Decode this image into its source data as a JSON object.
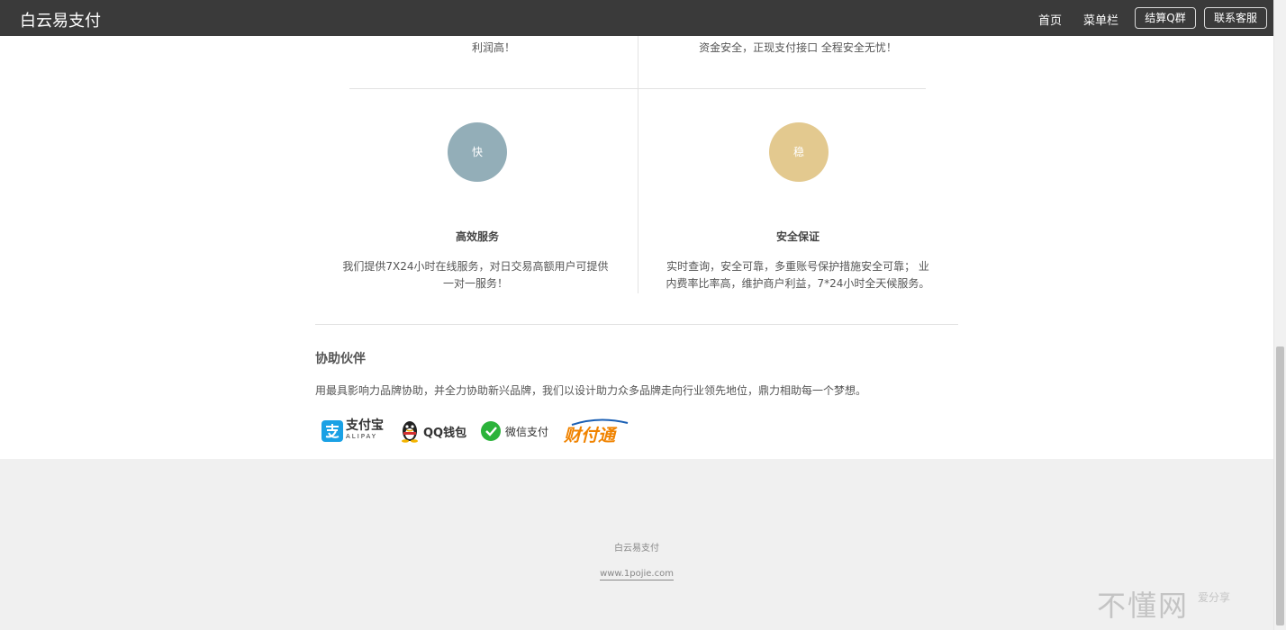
{
  "header": {
    "brand": "白云易支付",
    "nav": {
      "home": "首页",
      "menu": "菜单栏",
      "group_btn": "结算Q群",
      "contact_btn": "联系客服"
    }
  },
  "features": {
    "top_left_partial": "利润高！",
    "top_right_partial": "资金安全，正现支付接口 全程安全无忧！",
    "items": [
      {
        "icon_label": "快",
        "title": "高效服务",
        "desc": "我们提供7X24小时在线服务，对日交易高额用户可提供一对一服务！",
        "color": "#93aeb8"
      },
      {
        "icon_label": "稳",
        "title": "安全保证",
        "desc": "实时查询，安全可靠，多重账号保护措施安全可靠； 业内费率比率高，维护商户利益，7*24小时全天候服务。",
        "color": "#e3c98f"
      }
    ]
  },
  "partners": {
    "title": "协助伙伴",
    "desc": "用最具影响力品牌协助，并全力协助新兴品牌，我们以设计助力众多品牌走向行业领先地位，鼎力相助每一个梦想。",
    "logos": [
      {
        "name": "支付宝",
        "sub": "ALIPAY",
        "color": "#1aa1e5"
      },
      {
        "name": "QQ钱包",
        "color": "#333333"
      },
      {
        "name": "微信支付",
        "color": "#2bb33a"
      },
      {
        "name": "财付通",
        "color": "#f08300"
      }
    ]
  },
  "footer": {
    "name": "白云易支付",
    "url": "www.1pojie.com"
  },
  "watermark": {
    "main": "不懂网",
    "sub": "爱分享"
  }
}
